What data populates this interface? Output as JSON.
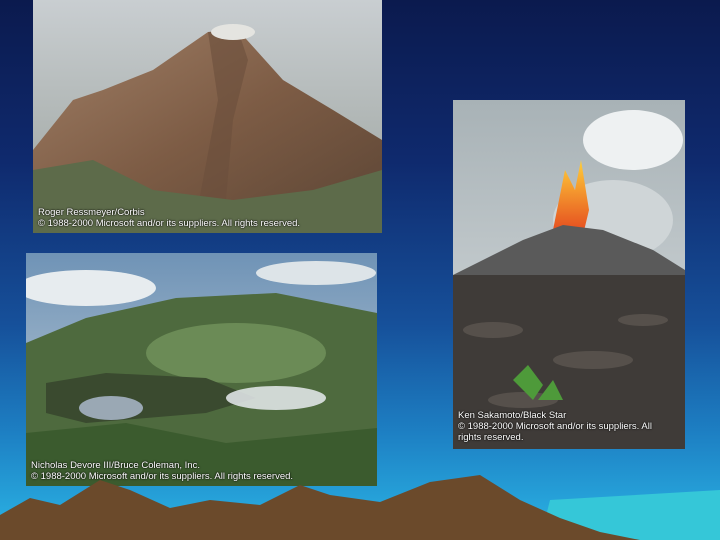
{
  "photos": [
    {
      "name": "stratovolcano",
      "credit_lines": [
        "Roger Ressmeyer/Corbis",
        "© 1988-2000 Microsoft and/or its suppliers. All rights reserved."
      ]
    },
    {
      "name": "lava-fountain",
      "credit_lines": [
        "Ken Sakamoto/Black Star",
        "© 1988-2000 Microsoft and/or its suppliers. All",
        "rights reserved."
      ]
    },
    {
      "name": "caldera",
      "credit_lines": [
        "Nicholas Devore III/Bruce Coleman, Inc.",
        "© 1988-2000 Microsoft and/or its suppliers. All rights reserved."
      ]
    }
  ],
  "colors": {
    "background_top": "#0b1a4e",
    "background_bottom": "#2bb6e6",
    "ground": "#6b4a2b",
    "water": "#35c7d8"
  }
}
